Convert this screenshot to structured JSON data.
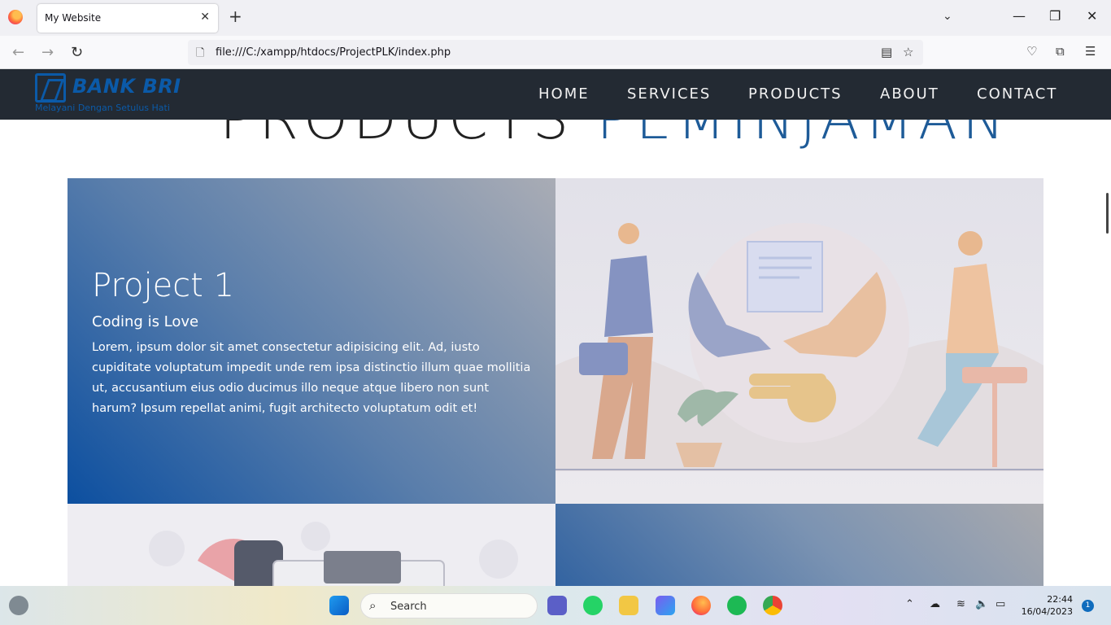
{
  "browser": {
    "tab_title": "My Website",
    "close_glyph": "✕",
    "newtab_glyph": "+",
    "url": "file:///C:/xampp/htdocs/ProjectPLK/index.php",
    "icons": [
      "back-icon",
      "forward-icon",
      "reload-icon",
      "page-icon",
      "reader-icon",
      "star-icon",
      "pocket-icon",
      "extensions-icon",
      "menu-icon"
    ]
  },
  "site": {
    "brand": {
      "name": "BANK BRI",
      "tagline": "Melayani Dengan Setulus Hati"
    },
    "menu": [
      "HOME",
      "SERVICES",
      "PRODUCTS",
      "ABOUT",
      "CONTACT"
    ],
    "heading_part1": "PRODUCTS",
    "heading_part2": "PEMINJAMAN",
    "card": {
      "title": "Project 1",
      "subtitle": "Coding is Love",
      "text": "Lorem, ipsum dolor sit amet consectetur adipisicing elit. Ad, iusto cupiditate voluptatum impedit unde rem ipsa distinctio illum quae mollitia ut, accusantium eius odio ducimus illo neque atque libero non sunt harum? Ipsum repellat animi, fugit architecto voluptatum odit et!"
    }
  },
  "taskbar": {
    "search_label": "Search",
    "time": "22:44",
    "date": "16/04/2023",
    "notification_count": "1"
  },
  "colors": {
    "brand_blue": "#0b5aa8",
    "nav_bg": "#232a33",
    "card_gradient_start": "#0c4fa0"
  }
}
